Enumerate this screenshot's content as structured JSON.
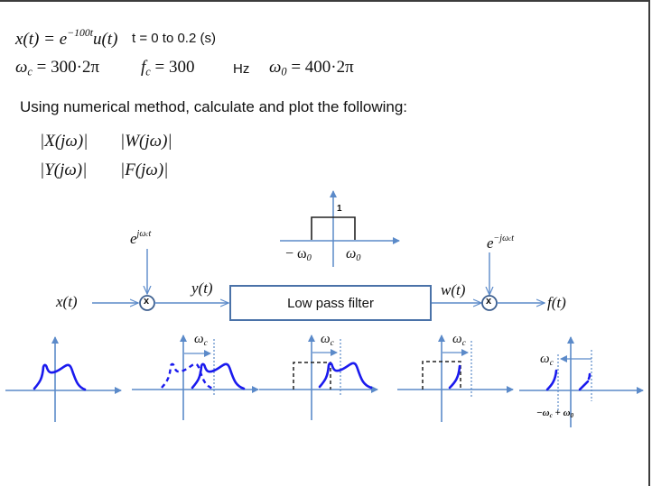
{
  "problem": {
    "line1": {
      "signal": "x(t) = e",
      "exponent": "−100t",
      "signal_tail": "u(t)",
      "time_range": "t = 0 to 0.2 (s)"
    },
    "line2": {
      "omega_c": "ω",
      "omega_c_sub": "c",
      "omega_c_value": " = 300·2π",
      "f_c": "f",
      "f_c_sub": "c",
      "f_c_value": " = 300",
      "f_c_unit": "Hz",
      "omega_0": "ω",
      "omega_0_sub": "0",
      "omega_0_value": " = 400·2π"
    },
    "instruction": "Using numerical method, calculate and plot the following:",
    "quantities": [
      "|X(jω)|",
      "|W(jω)|",
      "|Y(jω)|",
      "|F(jω)|"
    ]
  },
  "diagram": {
    "input_label": "x(t)",
    "mixer1_carrier": "e",
    "mixer1_carrier_exp": "jω",
    "mixer1_carrier_exp_sub": "c",
    "mixer1_carrier_exp_tail": "t",
    "mixer_symbol": "x",
    "y_label": "y(t)",
    "filter_label": "Low pass filter",
    "w_label": "w(t)",
    "mixer2_carrier": "e",
    "mixer2_carrier_exp": "−jω",
    "mixer2_carrier_exp_sub": "c",
    "mixer2_carrier_exp_tail": "t",
    "output_label": "f(t)",
    "filter_response": {
      "gain_label": "1",
      "neg_cutoff": "− ω",
      "neg_cutoff_sub": "0",
      "pos_cutoff": "ω",
      "pos_cutoff_sub": "0"
    }
  },
  "spectra": {
    "shift_label": "ω",
    "shift_label_sub": "c",
    "final_label": "−ω",
    "final_label_sub": "c",
    "final_label_mid": " + ω",
    "final_label_sub2": "0"
  },
  "colors": {
    "axis": "#5b8ac9",
    "curve": "#1a1aee",
    "box_dash": "#222222",
    "block_border": "#4a72a8"
  }
}
